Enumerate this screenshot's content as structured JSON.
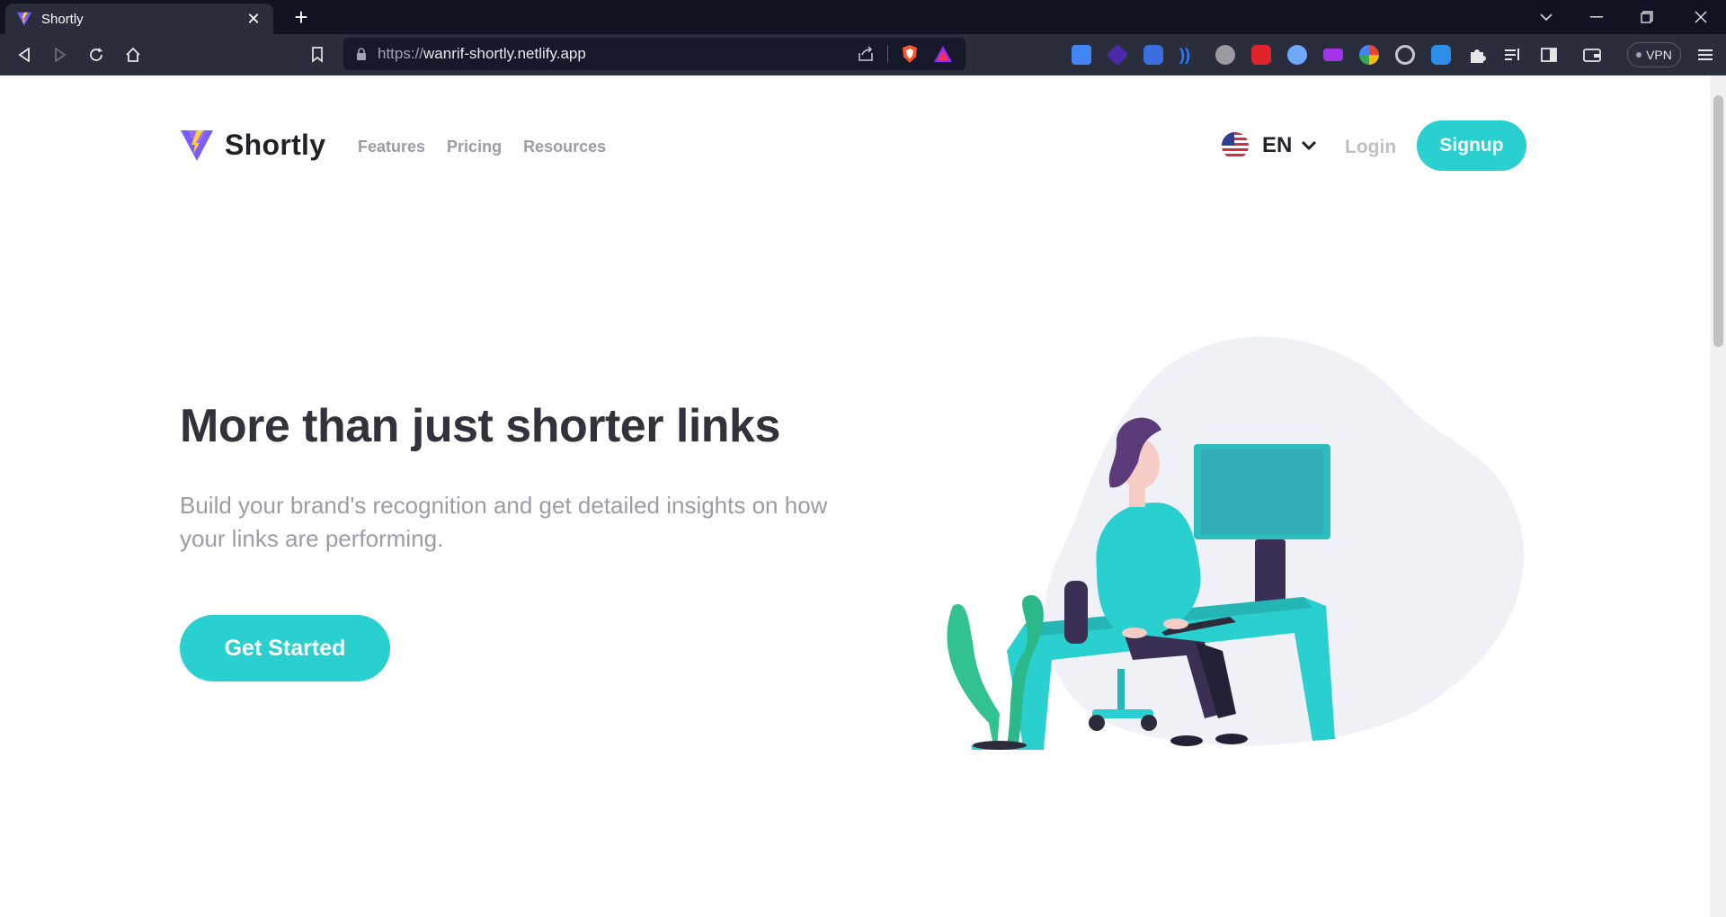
{
  "browser": {
    "tab_title": "Shortly",
    "url_scheme": "https://",
    "url_host": "wanrif-shortly.netlify.app",
    "vpn_label": "VPN",
    "new_tab_symbol": "+",
    "tab_close_symbol": "✕"
  },
  "site": {
    "logo_text": "Shortly",
    "nav": [
      "Features",
      "Pricing",
      "Resources"
    ],
    "language": "EN",
    "login": "Login",
    "signup": "Signup"
  },
  "hero": {
    "title": "More than just shorter links",
    "subtitle": "Build your brand's recognition and get detailed insights on how your links are performing.",
    "cta": "Get Started"
  },
  "colors": {
    "accent": "#2acfcf",
    "dark_text": "#34313d",
    "gray_text": "#9e9aa7",
    "violet": "#3b3054"
  }
}
